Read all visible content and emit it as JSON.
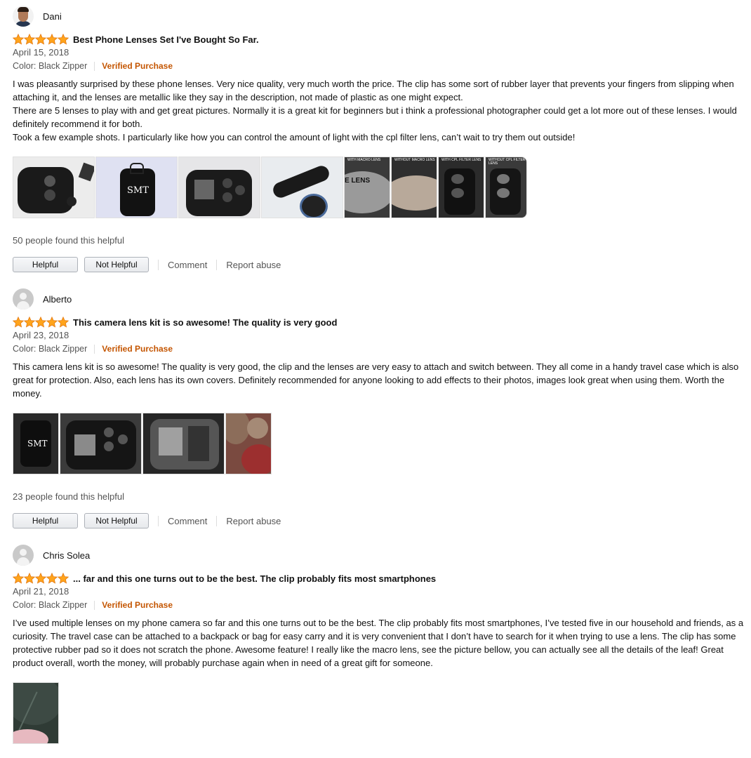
{
  "colors": {
    "star": "#ffa41c",
    "verified": "#c45500",
    "meta": "#555555"
  },
  "icons": {
    "rating": "star-icon",
    "avatar_generic": "user-silhouette-icon"
  },
  "reviews": [
    {
      "name": "Dani",
      "rating": 5,
      "title": "Best Phone Lenses Set I've Bought So Far.",
      "date": "April 15, 2018",
      "variant": "Color: Black Zipper",
      "verified": "Verified Purchase",
      "paragraphs": [
        "I was pleasantly surprised by these phone lenses. Very nice quality, very much worth the price. The clip has some sort of rubber layer that prevents your fingers from slipping when attaching it, and the lenses are metallic like they say in the description, not made of plastic as one might expect.",
        "There are 5 lenses to play with and get great pictures. Normally it is a great kit for beginners but i think a professional photographer could get a lot more out of these lenses. I would definitely recommend it for both.",
        "Took a few example shots. I particularly like how you can control the amount of light with the cpl filter lens, can’t wait to try them out outside!"
      ],
      "image_labels": [
        "SMT",
        "WITH MACRO LENS",
        "WITHOUT MACRO LENS",
        "E LENS",
        "WITH CPL FILTER LENS",
        "WITHOUT CPL FILTER LENS"
      ],
      "helpful_text": "50 people found this helpful",
      "helpful_label": "Helpful",
      "not_helpful_label": "Not Helpful",
      "comment_label": "Comment",
      "report_label": "Report abuse"
    },
    {
      "name": "Alberto",
      "rating": 5,
      "title": "This camera lens kit is so awesome! The quality is very good",
      "date": "April 23, 2018",
      "variant": "Color: Black Zipper",
      "verified": "Verified Purchase",
      "paragraphs": [
        "This camera lens kit is so awesome! The quality is very good, the clip and the lenses are very easy to attach and switch between. They all come in a handy travel case which is also great for protection. Also, each lens has its own covers. Definitely recommended for anyone looking to add effects to their photos, images look great when using them. Worth the money."
      ],
      "image_labels": [
        "SMT"
      ],
      "helpful_text": "23 people found this helpful",
      "helpful_label": "Helpful",
      "not_helpful_label": "Not Helpful",
      "comment_label": "Comment",
      "report_label": "Report abuse"
    },
    {
      "name": "Chris Solea",
      "rating": 5,
      "title": "... far and this one turns out to be the best. The clip probably fits most smartphones",
      "date": "April 21, 2018",
      "variant": "Color: Black Zipper",
      "verified": "Verified Purchase",
      "paragraphs": [
        "I’ve used multiple lenses on my phone camera so far and this one turns out to be the best. The clip probably fits most smartphones, I’ve tested five in our household and friends, as a curiosity. The travel case can be attached to a backpack or bag for easy carry and it is very convenient that I don’t have to search for it when trying to use a lens. The clip has some protective rubber pad so it does not scratch the phone. Awesome feature! I really like the macro lens, see the picture bellow, you can actually see all the details of the leaf! Great product overall, worth the money, will probably purchase again when in need of a great gift for someone."
      ]
    }
  ]
}
